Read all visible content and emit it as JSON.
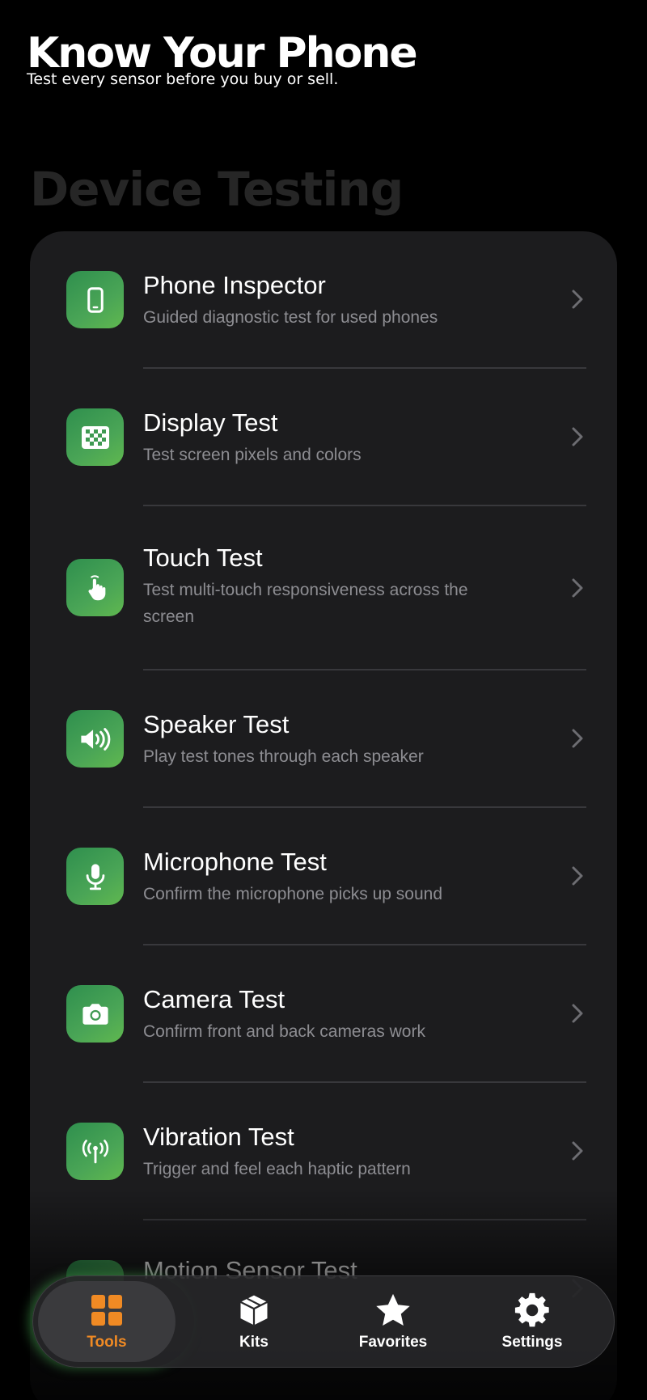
{
  "header": {
    "title": "Know Your Phone",
    "subtitle": "Test every sensor before you buy or sell."
  },
  "section": {
    "title": "Device Testing"
  },
  "colors": {
    "accent": "#f08a24",
    "icon_green": "#4aa556",
    "card_bg": "#1c1c1e",
    "subtitle_gray": "#8d8d92"
  },
  "tools": [
    {
      "title": "Phone Inspector",
      "subtitle": "Guided diagnostic test for used phones",
      "icon": "phone-icon"
    },
    {
      "title": "Display Test",
      "subtitle": "Test screen pixels and colors",
      "icon": "checkerboard-icon"
    },
    {
      "title": "Touch Test",
      "subtitle": "Test multi-touch responsiveness across the screen",
      "icon": "hand-tap-icon"
    },
    {
      "title": "Speaker Test",
      "subtitle": "Play test tones through each speaker",
      "icon": "speaker-icon"
    },
    {
      "title": "Microphone Test",
      "subtitle": "Confirm the microphone picks up sound",
      "icon": "microphone-icon"
    },
    {
      "title": "Camera Test",
      "subtitle": "Confirm front and back cameras work",
      "icon": "camera-icon"
    },
    {
      "title": "Vibration Test",
      "subtitle": "Trigger and feel each haptic pattern",
      "icon": "vibration-icon"
    },
    {
      "title": "Motion Sensor Test",
      "subtitle": "",
      "icon": "motion-icon"
    }
  ],
  "tabbar": {
    "active": "Tools",
    "tabs": [
      {
        "label": "Tools",
        "icon": "grid-icon"
      },
      {
        "label": "Kits",
        "icon": "box-icon"
      },
      {
        "label": "Favorites",
        "icon": "star-icon"
      },
      {
        "label": "Settings",
        "icon": "gear-icon"
      }
    ]
  }
}
